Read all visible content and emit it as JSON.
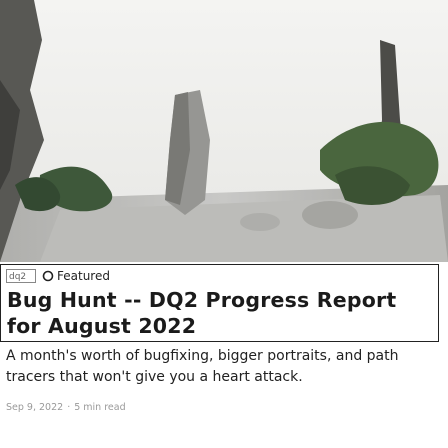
{
  "post": {
    "image_alt": "Featured image",
    "logo_text": "dq2",
    "badge_label": "Featured",
    "title": "Bug Hunt -- DQ2 Progress Report for August 2022",
    "excerpt": "A month's worth of bugfixing, bigger portraits, and path tracers that won't give you a heart attack.",
    "date": "Sep 9, 2022",
    "separator": "·",
    "read_time": "5 min read"
  },
  "colors": {
    "text": "#1b1b1b",
    "muted": "#9a9a9a",
    "border": "#222222"
  },
  "icons": {
    "featured": "circle-outline-icon"
  }
}
